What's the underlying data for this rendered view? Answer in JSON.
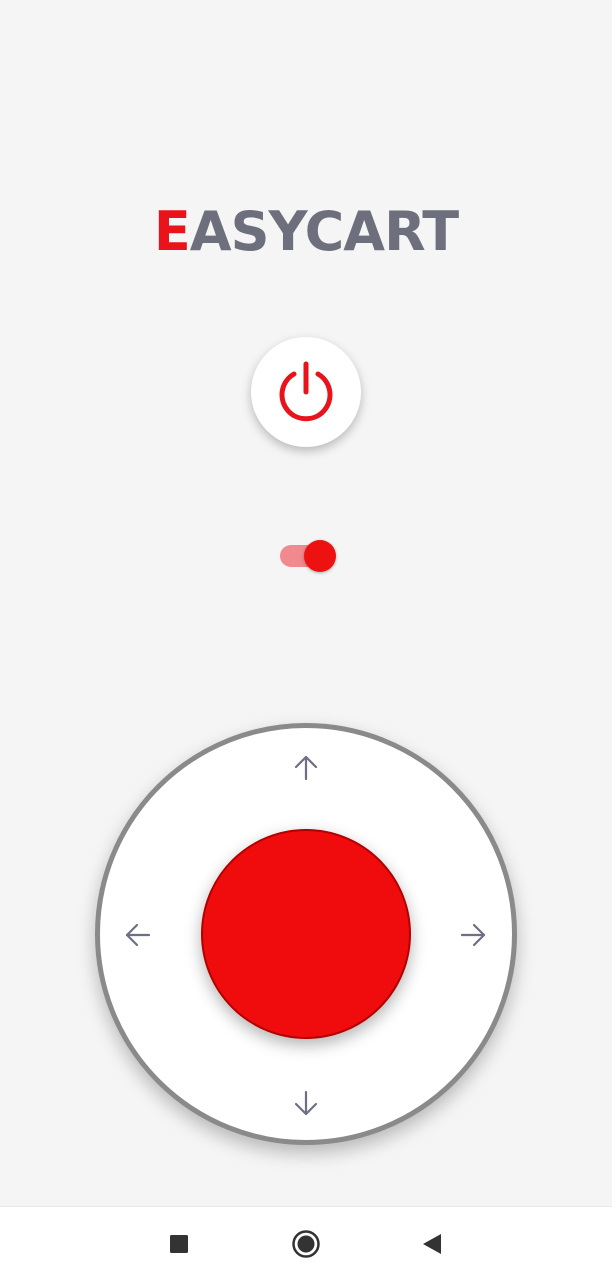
{
  "app": {
    "logo_first": "E",
    "logo_rest": "ASYCART"
  },
  "power_button": {
    "icon": "power-icon",
    "color": "#e8131b"
  },
  "toggle": {
    "state": "on",
    "track_color": "#f08a8e",
    "thumb_color": "#ee1111"
  },
  "joystick": {
    "knob_color": "#f00c0c",
    "ring_color": "#8a8a8a",
    "arrows": [
      "arrow-up-icon",
      "arrow-down-icon",
      "arrow-left-icon",
      "arrow-right-icon"
    ],
    "arrow_color": "#6e6e85"
  },
  "navbar": {
    "buttons": [
      "recents-square-icon",
      "home-circle-icon",
      "back-triangle-icon"
    ]
  }
}
